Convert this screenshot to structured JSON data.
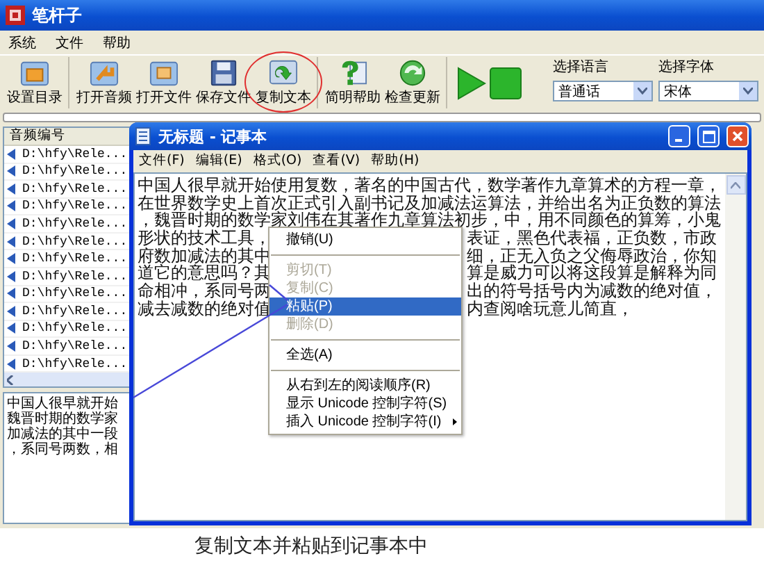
{
  "app": {
    "title": "笔杆子",
    "menu": [
      "系统",
      "文件",
      "帮助"
    ],
    "toolbar_groups": [
      {
        "buttons": [
          {
            "label": "设置目录",
            "highlighted": false
          }
        ]
      },
      {
        "buttons": [
          {
            "label": "打开音频",
            "highlighted": false
          },
          {
            "label": "打开文件",
            "highlighted": false
          },
          {
            "label": "保存文件",
            "highlighted": false
          },
          {
            "label": "复制文本",
            "highlighted": true
          }
        ]
      },
      {
        "buttons": [
          {
            "label": "简明帮助",
            "highlighted": false
          },
          {
            "label": "检查更新",
            "highlighted": false
          }
        ]
      }
    ],
    "playback": [
      {
        "kind": "play"
      },
      {
        "kind": "stop"
      }
    ],
    "selectors": [
      {
        "label": "选择语言",
        "value": "普通话"
      },
      {
        "label": "选择字体",
        "value": "宋体"
      }
    ],
    "file_list": {
      "column": "音频编号",
      "rows": [
        "D:\\hfy\\Rele...",
        "D:\\hfy\\Rele...",
        "D:\\hfy\\Rele...",
        "D:\\hfy\\Rele...",
        "D:\\hfy\\Rele...",
        "D:\\hfy\\Rele...",
        "D:\\hfy\\Rele...",
        "D:\\hfy\\Rele...",
        "D:\\hfy\\Rele...",
        "D:\\hfy\\Rele...",
        "D:\\hfy\\Rele...",
        "D:\\hfy\\Rele...",
        "D:\\hfy\\Rele..."
      ]
    },
    "preview_lines": [
      "中国人很早就开始",
      "魏晋时期的数学家",
      "加减法的其中一段",
      "，系同号两数，相"
    ]
  },
  "notepad": {
    "title": "无标题 - 记事本",
    "menu": [
      "文件(F)",
      "编辑(E)",
      "格式(O)",
      "查看(V)",
      "帮助(H)"
    ],
    "lines": [
      {
        "left": "中国人很早就开始使用复数，著名的中国古代，数学著作九章算术的方程一章，"
      },
      {
        "left": "在世界数学史上首次正式引入副书记及加减法运算法，并给出名为正负数的算法"
      },
      {
        "left": "，魏晋时期的数学家刘伟在其著作九章算法初步，中，用不同颜色的算筹，小鬼"
      },
      {
        "left": "形状的技术工具，",
        "right": "表证，黑色代表福，正负数，市政"
      },
      {
        "left": "府数加减法的其中",
        "right": "细，正无入负之父侮辱政治，你知"
      },
      {
        "left": "道它的意思吗？其",
        "right": "算是威力可以将这段算是解释为同"
      },
      {
        "left": "命相冲，系同号两",
        "right": "出的符号括号内为减数的绝对值，"
      },
      {
        "left": "减去减数的绝对值",
        "right": "内查阅啥玩意儿简直，"
      }
    ]
  },
  "context_menu": {
    "items": [
      {
        "kind": "item",
        "label": "撤销(U)",
        "disabled": false,
        "selected": false
      },
      {
        "kind": "separator"
      },
      {
        "kind": "item",
        "label": "剪切(T)",
        "disabled": true,
        "selected": false
      },
      {
        "kind": "item",
        "label": "复制(C)",
        "disabled": true,
        "selected": false
      },
      {
        "kind": "item",
        "label": "粘贴(P)",
        "disabled": false,
        "selected": true
      },
      {
        "kind": "item",
        "label": "删除(D)",
        "disabled": true,
        "selected": false
      },
      {
        "kind": "separator"
      },
      {
        "kind": "item",
        "label": "全选(A)",
        "disabled": false,
        "selected": false
      },
      {
        "kind": "separator"
      },
      {
        "kind": "item",
        "label": "从右到左的阅读顺序(R)",
        "disabled": false,
        "selected": false
      },
      {
        "kind": "item",
        "label": "显示 Unicode 控制字符(S)",
        "disabled": false,
        "selected": false
      },
      {
        "kind": "submenu",
        "label": "插入 Unicode 控制字符(I)",
        "disabled": false,
        "selected": false
      }
    ]
  },
  "caption": "复制文本并粘贴到记事本中"
}
